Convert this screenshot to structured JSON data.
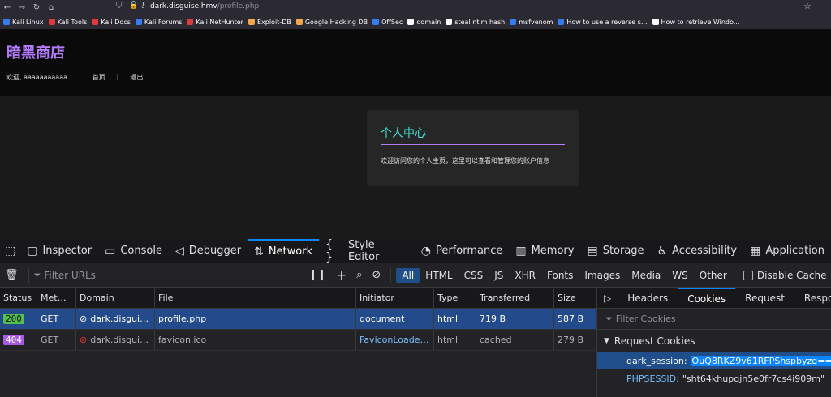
{
  "browser": {
    "url_host": "dark.disguise.hmv",
    "url_path": "/profile.php",
    "bookmarks": [
      {
        "label": "Kali Linux",
        "color": "#367bf0"
      },
      {
        "label": "Kali Tools",
        "color": "#e03a3a"
      },
      {
        "label": "Kali Docs",
        "color": "#e03a3a"
      },
      {
        "label": "Kali Forums",
        "color": "#367bf0"
      },
      {
        "label": "Kali NetHunter",
        "color": "#e03a3a"
      },
      {
        "label": "Exploit-DB",
        "color": "#f2a74b"
      },
      {
        "label": "Google Hacking DB",
        "color": "#f2a74b"
      },
      {
        "label": "OffSec",
        "color": "#367bf0"
      },
      {
        "label": "domain",
        "color": "#fbfbfe"
      },
      {
        "label": "steal ntlm hash",
        "color": "#fbfbfe"
      },
      {
        "label": "msfvenom",
        "color": "#367bf0"
      },
      {
        "label": "How to use a reverse s...",
        "color": "#367bf0"
      },
      {
        "label": "How to retrieve Windo...",
        "color": "#fbfbfe"
      }
    ]
  },
  "site": {
    "title": "暗黑商店",
    "nav": {
      "welcome": "欢迎, aaaaaaaaaaa",
      "sep": "|",
      "home": "首页",
      "logout": "退出"
    },
    "card": {
      "title": "个人中心",
      "text": "欢迎访问您的个人主页，这里可以查看和管理您的账户信息"
    }
  },
  "devtools": {
    "tabs": [
      {
        "label": "Inspector",
        "icon": "▢"
      },
      {
        "label": "Console",
        "icon": "▭"
      },
      {
        "label": "Debugger",
        "icon": "◁"
      },
      {
        "label": "Network",
        "icon": "⇅"
      },
      {
        "label": "Style Editor",
        "icon": "{ }"
      },
      {
        "label": "Performance",
        "icon": "◔"
      },
      {
        "label": "Memory",
        "icon": "▥"
      },
      {
        "label": "Storage",
        "icon": "▤"
      },
      {
        "label": "Accessibility",
        "icon": "♿"
      },
      {
        "label": "Application",
        "icon": "▦"
      }
    ],
    "toolbar": {
      "filter_placeholder": "Filter URLs",
      "filters": [
        "All",
        "HTML",
        "CSS",
        "JS",
        "XHR",
        "Fonts",
        "Images",
        "Media",
        "WS",
        "Other"
      ],
      "disable_cache": "Disable Cache"
    },
    "table": {
      "headers": [
        "Status",
        "Met…",
        "Domain",
        "File",
        "Initiator",
        "Type",
        "Transferred",
        "Size"
      ],
      "rows": [
        {
          "status": "200",
          "method": "GET",
          "domain": "dark.disgui…",
          "file": "profile.php",
          "initiator": "document",
          "type": "html",
          "transferred": "719 B",
          "size": "587 B"
        },
        {
          "status": "404",
          "method": "GET",
          "domain": "dark.disgui…",
          "file": "favicon.ico",
          "initiator": "FaviconLoade…",
          "type": "html",
          "transferred": "cached",
          "size": "279 B"
        }
      ]
    },
    "side": {
      "tabs": [
        "Headers",
        "Cookies",
        "Request",
        "Respo"
      ],
      "filter_placeholder": "Filter Cookies",
      "section": "Request Cookies",
      "cookies": [
        {
          "key": "dark_session:",
          "value": "OuQ8RKZ9v61RFPShspbyzg=="
        },
        {
          "key": "PHPSESSID:",
          "value": "\"sht64khupqjn5e0fr7cs4i909m\""
        }
      ]
    }
  }
}
